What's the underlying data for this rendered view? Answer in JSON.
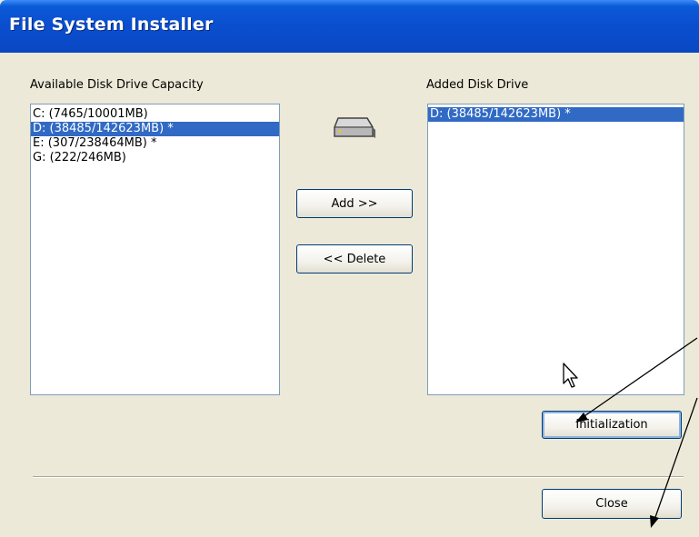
{
  "window": {
    "title": "File System Installer"
  },
  "available": {
    "label": "Available Disk Drive Capacity",
    "items": [
      {
        "text": "C:  (7465/10001MB)",
        "selected": false
      },
      {
        "text": "D:  (38485/142623MB) *",
        "selected": true
      },
      {
        "text": "E:  (307/238464MB) *",
        "selected": false
      },
      {
        "text": "G:  (222/246MB)",
        "selected": false
      }
    ]
  },
  "added": {
    "label": "Added Disk Drive",
    "items": [
      {
        "text": "D:  (38485/142623MB) *",
        "selected": true
      }
    ]
  },
  "buttons": {
    "add": "Add >>",
    "delete": "<< Delete",
    "initialization": "Initialization",
    "close": "Close"
  },
  "icons": {
    "drive": "hard-drive-icon",
    "cursor": "mouse-pointer-icon",
    "annotation": "annotation-arrow"
  },
  "colors": {
    "titlebar": "#0a4fd0",
    "selection": "#316ac5",
    "background": "#ece9d8"
  }
}
